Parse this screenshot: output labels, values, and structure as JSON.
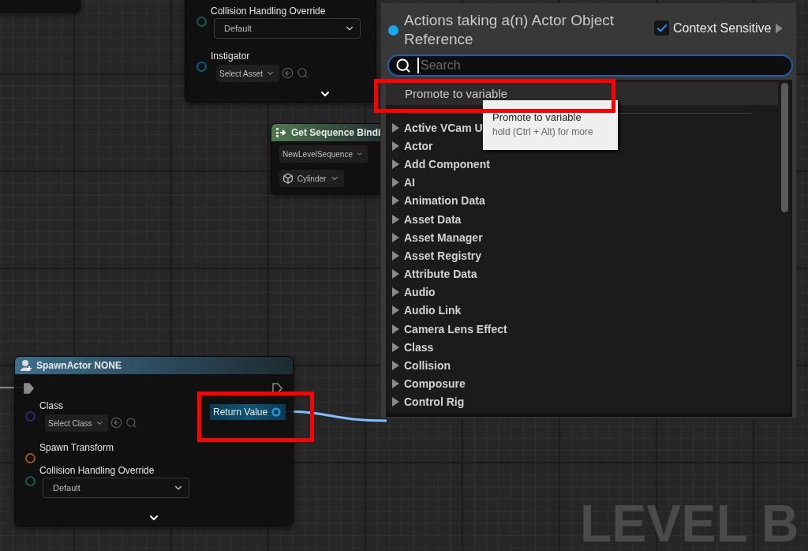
{
  "top_node": {
    "rows": [
      {
        "kind": "enum",
        "label": "Collision Handling Override",
        "value": "Default",
        "color": "#1d5a52"
      },
      {
        "kind": "object",
        "label": "Instigator",
        "value": "Select Asset",
        "color": "#0d5f80"
      }
    ]
  },
  "sequence_node": {
    "title": "Get Sequence Bindi",
    "fields": [
      {
        "kind": "asset",
        "value": "NewLevelSequence"
      },
      {
        "kind": "mesh",
        "value": "Cylinder"
      }
    ]
  },
  "spawn_node": {
    "title": "SpawnActor NONE",
    "output": "Return Value",
    "rows": [
      {
        "kind": "object",
        "label": "Class",
        "value": "Select Class",
        "color": "#3a1f6e"
      },
      {
        "kind": "pin",
        "label": "Spawn Transform",
        "color": "#a3561a"
      },
      {
        "kind": "enum",
        "label": "Collision Handling Override",
        "value": "Default",
        "color": "#1d5a52"
      }
    ]
  },
  "action_menu": {
    "title": "Actions taking a(n) Actor Object Reference",
    "context_sensitive": {
      "label": "Context Sensitive",
      "checked": true
    },
    "search": {
      "placeholder": "Search"
    },
    "top_item": {
      "label": "Promote to variable",
      "selected": true
    },
    "categories": [
      "Active VCam U",
      "Actor",
      "Add Component",
      "AI",
      "Animation Data",
      "Asset Data",
      "Asset Manager",
      "Asset Registry",
      "Attribute Data",
      "Audio",
      "Audio Link",
      "Camera Lens Effect",
      "Class",
      "Collision",
      "Composure",
      "Control Rig"
    ],
    "tooltip": {
      "title": "Promote to variable",
      "hint": "hold (Ctrl + Alt) for more"
    }
  },
  "watermark": "LEVEL B"
}
